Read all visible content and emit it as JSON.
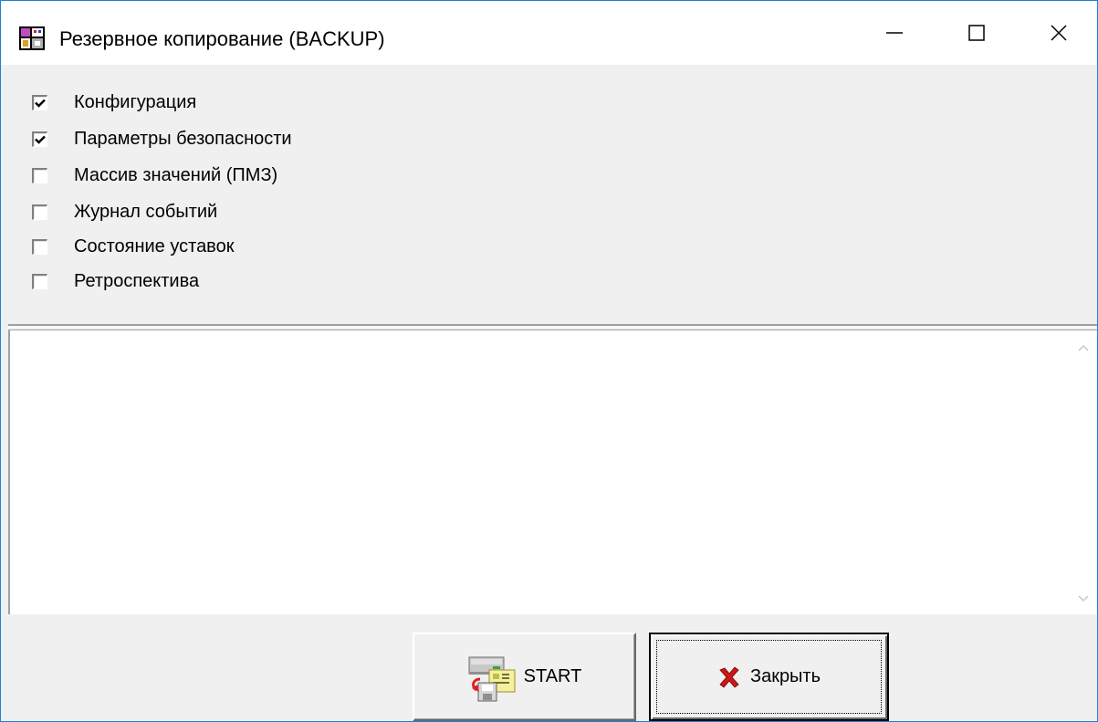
{
  "window": {
    "title": "Резервное копирование (BACKUP)",
    "accent_color": "#1883d7"
  },
  "options": [
    {
      "label": "Конфигурация",
      "checked": true
    },
    {
      "label": "Параметры безопасности",
      "checked": true
    },
    {
      "label": "Массив значений (ПМЗ)",
      "checked": false
    },
    {
      "label": "Журнал событий",
      "checked": false
    },
    {
      "label": "Состояние уставок",
      "checked": false
    },
    {
      "label": "Ретроспектива",
      "checked": false
    }
  ],
  "log": {
    "text": ""
  },
  "buttons": {
    "start_label": "START",
    "start_icon": "backup-drive-icon",
    "close_label": "Закрыть",
    "close_icon": "red-x-icon"
  }
}
